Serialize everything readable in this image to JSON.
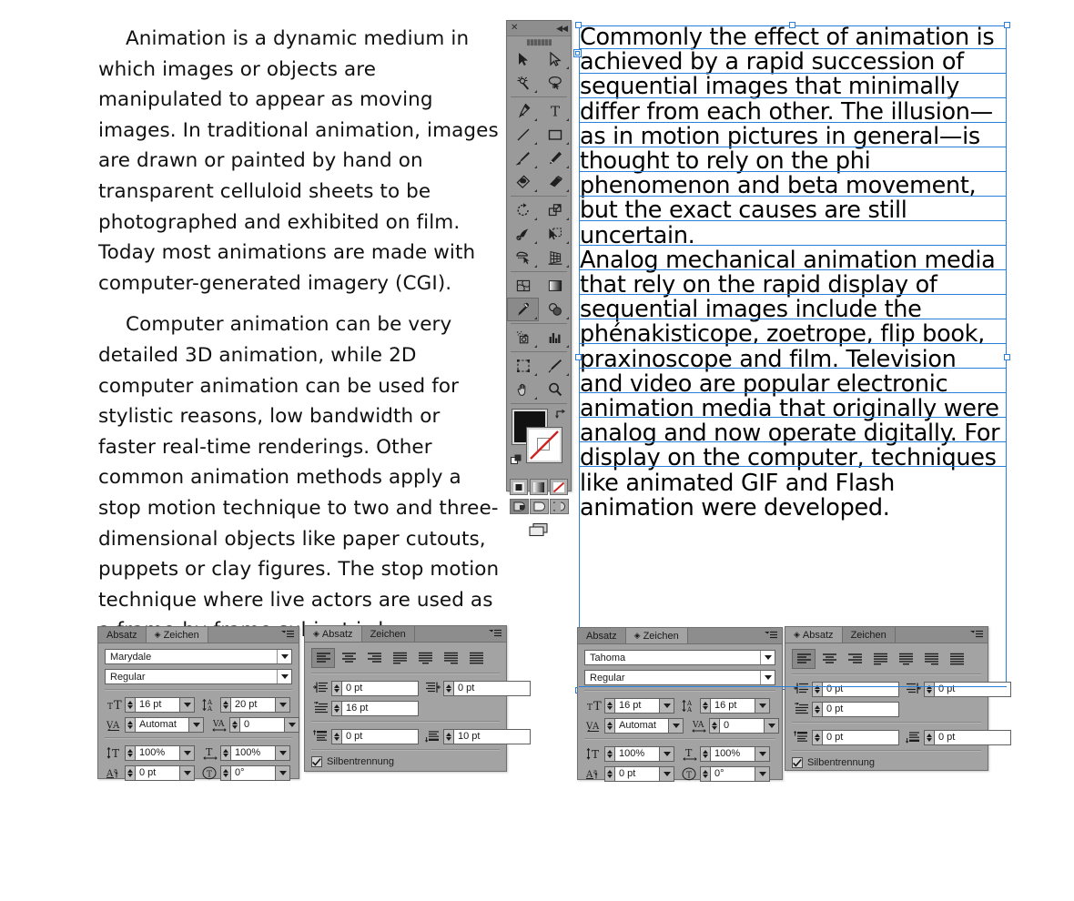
{
  "document": {
    "handwritten_paragraphs": [
      "Animation is a dynamic medium in which images or objects are manipulated to appear as moving images. In traditional animation, images are drawn or painted by hand on transparent celluloid sheets to be photographed and exhibited on film. Today most animations are made with computer-generated imagery (CGI).",
      "Computer animation can be very detailed 3D animation, while 2D computer animation can be used for stylistic reasons, low bandwidth or faster real-time renderings. Other common animation methods apply a stop motion technique to two and three-dimensional objects like paper cutouts, puppets or clay figures. The stop motion technique where live actors are used as a frame-by-frame subject is known as pixilation."
    ],
    "selected_frame_paragraphs": [
      "Commonly the effect of animation is achieved by a rapid succession of sequential images that minimally differ from each other. The illusion—as in motion pictures in general—is thought to rely on the phi phenomenon and beta movement, but the exact causes are still uncertain.",
      "Analog mechanical animation media that rely on the rapid display of sequential images include the phénakisticope, zoetrope, flip book, praxinoscope and film. Television and video are popular electronic animation media that originally were analog and now operate digitally. For display on the computer, techniques like animated GIF and Flash animation were developed."
    ]
  },
  "colors": {
    "selection_blue": "#2a7fdc",
    "panel_gray": "#a3a3a3",
    "panel_tabbar_gray": "#8d8d8d",
    "toolbar_gray": "#9a9a9a",
    "field_white": "#ffffff",
    "fill_swatch": "#111111",
    "stroke_none_red": "#cc2222"
  },
  "tools_palette": {
    "close_label": "✕",
    "collapse_label": "◀◀",
    "gripper": "▮▮▮▮▮▮▮",
    "tools": [
      {
        "name": "selection-tool",
        "glyph": "selection"
      },
      {
        "name": "direct-selection-tool",
        "glyph": "direct-selection"
      },
      {
        "name": "magic-wand-tool",
        "glyph": "magic-wand"
      },
      {
        "name": "lasso-tool",
        "glyph": "lasso"
      },
      {
        "name": "pen-tool",
        "glyph": "pen"
      },
      {
        "name": "type-tool",
        "glyph": "type"
      },
      {
        "name": "line-segment-tool",
        "glyph": "line"
      },
      {
        "name": "rectangle-tool",
        "glyph": "rectangle"
      },
      {
        "name": "paintbrush-tool",
        "glyph": "paintbrush"
      },
      {
        "name": "pencil-tool",
        "glyph": "pencil"
      },
      {
        "name": "blob-brush-tool",
        "glyph": "blob-brush"
      },
      {
        "name": "eraser-tool",
        "glyph": "eraser"
      },
      {
        "name": "rotate-tool",
        "glyph": "rotate"
      },
      {
        "name": "scale-tool",
        "glyph": "scale"
      },
      {
        "name": "width-tool",
        "glyph": "width"
      },
      {
        "name": "free-transform-tool",
        "glyph": "free-transform"
      },
      {
        "name": "shape-builder-tool",
        "glyph": "shape-builder"
      },
      {
        "name": "perspective-grid-tool",
        "glyph": "perspective-grid"
      },
      {
        "name": "mesh-tool",
        "glyph": "mesh"
      },
      {
        "name": "gradient-tool",
        "glyph": "gradient"
      },
      {
        "name": "eyedropper-tool",
        "glyph": "eyedropper",
        "selected": true
      },
      {
        "name": "blend-tool",
        "glyph": "blend"
      },
      {
        "name": "symbol-sprayer-tool",
        "glyph": "symbol-sprayer"
      },
      {
        "name": "column-graph-tool",
        "glyph": "column-graph"
      },
      {
        "name": "artboard-tool",
        "glyph": "artboard"
      },
      {
        "name": "slice-tool",
        "glyph": "slice"
      },
      {
        "name": "hand-tool",
        "glyph": "hand"
      },
      {
        "name": "zoom-tool",
        "glyph": "zoom"
      }
    ],
    "paint_modes": [
      "color-swatch",
      "gradient-swatch",
      "none-swatch"
    ],
    "draw_modes": [
      "draw-normal",
      "draw-behind",
      "draw-inside"
    ],
    "screen_mode": "change-screen-mode"
  },
  "panels": {
    "character_left": {
      "tabs": [
        {
          "label": "Absatz",
          "active": false
        },
        {
          "label": "Zeichen",
          "active": true
        }
      ],
      "font_family": "Marydale",
      "font_style": "Regular",
      "font_size": "16 pt",
      "leading": "20 pt",
      "kerning": "Automat",
      "tracking": "0",
      "vertical_scale": "100%",
      "horizontal_scale": "100%",
      "baseline_shift": "0 pt",
      "character_rotation": "0°"
    },
    "paragraph_left": {
      "tabs": [
        {
          "label": "Absatz",
          "active": true
        },
        {
          "label": "Zeichen",
          "active": false
        }
      ],
      "align_selected_index": 0,
      "align_options": [
        "align-left",
        "align-center",
        "align-right",
        "justify-last-left",
        "justify-last-center",
        "justify-last-right",
        "justify-all"
      ],
      "indent_left": "0 pt",
      "indent_right": "0 pt",
      "indent_first_line": "16 pt",
      "space_before": "0 pt",
      "space_after": "10 pt",
      "hyphenation_label": "Silbentrennung",
      "hyphenation_checked": true
    },
    "character_right": {
      "tabs": [
        {
          "label": "Absatz",
          "active": false
        },
        {
          "label": "Zeichen",
          "active": true
        }
      ],
      "font_family": "Tahoma",
      "font_style": "Regular",
      "font_size": "16 pt",
      "leading": "16 pt",
      "kerning": "Automat",
      "tracking": "0",
      "vertical_scale": "100%",
      "horizontal_scale": "100%",
      "baseline_shift": "0 pt",
      "character_rotation": "0°"
    },
    "paragraph_right": {
      "tabs": [
        {
          "label": "Absatz",
          "active": true
        },
        {
          "label": "Zeichen",
          "active": false
        }
      ],
      "align_selected_index": 0,
      "align_options": [
        "align-left",
        "align-center",
        "align-right",
        "justify-last-left",
        "justify-last-center",
        "justify-last-right",
        "justify-all"
      ],
      "indent_left": "0 pt",
      "indent_right": "0 pt",
      "indent_first_line": "0 pt",
      "space_before": "0 pt",
      "space_after": "0 pt",
      "hyphenation_label": "Silbentrennung",
      "hyphenation_checked": true
    }
  }
}
